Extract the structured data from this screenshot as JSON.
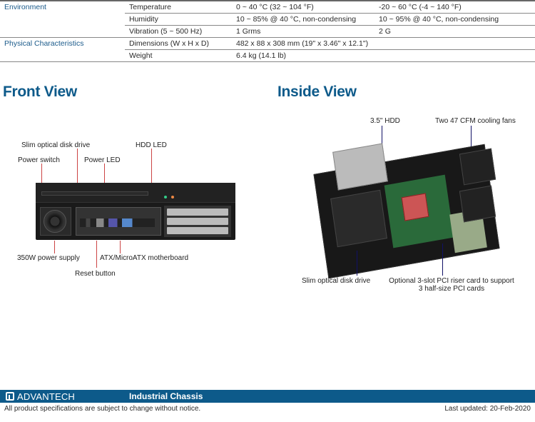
{
  "specs": {
    "env_cat": "Environment",
    "temp_label": "Temperature",
    "temp_op": "0 ~ 40 °C (32 ~ 104 °F)",
    "temp_nonop": "-20 ~ 60 °C (-4 ~ 140 °F)",
    "hum_label": "Humidity",
    "hum_op": "10 ~ 85% @ 40 °C, non-condensing",
    "hum_nonop": "10 ~ 95% @ 40 °C, non-condensing",
    "vib_label": "Vibration (5 ~ 500 Hz)",
    "vib_op": "1 Grms",
    "vib_nonop": "2 G",
    "phys_cat": "Physical Characteristics",
    "dim_label": "Dimensions (W x H x D)",
    "dim_val": "482 x 88 x 308 mm (19\" x 3.46\" x 12.1\")",
    "wt_label": "Weight",
    "wt_val": "6.4 kg (14.1 lb)"
  },
  "views": {
    "front_title": "Front View",
    "inside_title": "Inside View"
  },
  "front_labels": {
    "slim_optical": "Slim optical disk drive",
    "hdd_led": "HDD LED",
    "power_switch": "Power switch",
    "power_led": "Power LED",
    "psu": "350W power supply",
    "mb": "ATX/MicroATX motherboard",
    "reset": "Reset button"
  },
  "inside_labels": {
    "hdd": "3.5\" HDD",
    "fans": "Two 47 CFM cooling fans",
    "slim_optical": "Slim optical disk drive",
    "riser": "Optional 3-slot PCI riser card to support 3 half-size PCI cards"
  },
  "footer": {
    "brand": "ADVANTECH",
    "category": "Industrial Chassis",
    "notice": "All product specifications are subject to change without notice.",
    "updated": "Last updated: 20-Feb-2020"
  }
}
